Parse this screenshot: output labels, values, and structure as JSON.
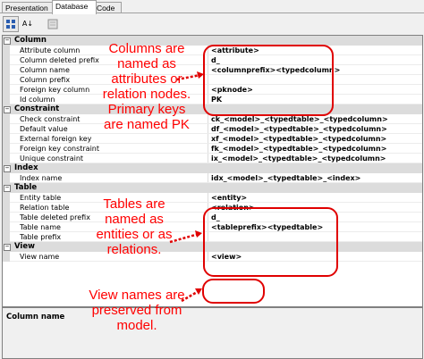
{
  "tabs": [
    {
      "label": "Presentation"
    },
    {
      "label": "Database"
    },
    {
      "label": "Code"
    }
  ],
  "toolbar": {
    "categorized_icon": "categorized-icon",
    "alphabetical_label": "A↓",
    "pages_icon": "property-pages-icon"
  },
  "grid": {
    "column_category": "Column",
    "column_rows": [
      {
        "name": "Attribute column",
        "value": "<attribute>"
      },
      {
        "name": "Column deleted prefix",
        "value": "d_"
      },
      {
        "name": "Column name",
        "value": "<columnprefix><typedcolumn>"
      },
      {
        "name": "Column prefix",
        "value": ""
      },
      {
        "name": "Foreign key column",
        "value": "<pknode>"
      },
      {
        "name": "Id column",
        "value": "PK"
      }
    ],
    "constraint_category": "Constraint",
    "constraint_rows": [
      {
        "name": "Check constraint",
        "value": "ck_<model>_<typedtable>_<typedcolumn>"
      },
      {
        "name": "Default value",
        "value": "df_<model>_<typedtable>_<typedcolumn>"
      },
      {
        "name": "External foreign key",
        "value": "xf_<model>_<typedtable>_<typedcolumn>"
      },
      {
        "name": "Foreign key constraint",
        "value": "fk_<model>_<typedtable>_<typedcolumn>"
      },
      {
        "name": "Unique constraint",
        "value": "ix_<model>_<typedtable>_<typedcolumn>"
      }
    ],
    "index_category": "Index",
    "index_rows": [
      {
        "name": "Index name",
        "value": "idx_<model>_<typedtable>_<index>"
      }
    ],
    "table_category": "Table",
    "table_rows": [
      {
        "name": "Entity table",
        "value": "<entity>"
      },
      {
        "name": "Relation table",
        "value": "<relation>"
      },
      {
        "name": "Table deleted prefix",
        "value": "d_"
      },
      {
        "name": "Table name",
        "value": "<tableprefix><typedtable>"
      },
      {
        "name": "Table prefix",
        "value": ""
      }
    ],
    "view_category": "View",
    "view_rows": [
      {
        "name": "View name",
        "value": "<view>"
      }
    ]
  },
  "help": {
    "title": "Column name"
  },
  "annotations": {
    "columns": "Columns are named as attributes or relation nodes. Primary keys are named PK",
    "tables": "Tables are named as entities or as relations.",
    "views": "View names are preserved from model."
  },
  "colors": {
    "annotation": "#ff0000",
    "category_bg": "#dcdcdc"
  }
}
